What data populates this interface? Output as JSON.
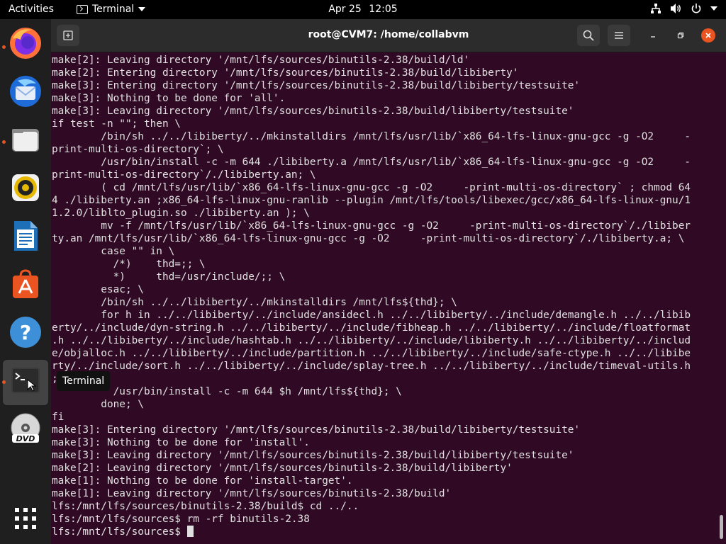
{
  "topbar": {
    "activities": "Activities",
    "app_name": "Terminal",
    "date": "Apr 25",
    "time": "12:05"
  },
  "dock": {
    "tooltip": "Terminal",
    "items": [
      "firefox",
      "thunderbird",
      "files",
      "rhythmbox",
      "libreoffice-writer",
      "ubuntu-software",
      "help",
      "terminal",
      "dvd",
      "show-applications"
    ]
  },
  "window": {
    "title": "root@CVM7: /home/collabvm"
  },
  "terminal": {
    "lines": [
      "make[2]: Leaving directory '/mnt/lfs/sources/binutils-2.38/build/ld'",
      "make[2]: Entering directory '/mnt/lfs/sources/binutils-2.38/build/libiberty'",
      "make[3]: Entering directory '/mnt/lfs/sources/binutils-2.38/build/libiberty/testsuite'",
      "make[3]: Nothing to be done for 'all'.",
      "make[3]: Leaving directory '/mnt/lfs/sources/binutils-2.38/build/libiberty/testsuite'",
      "if test -n \"\"; then \\",
      "        /bin/sh ../../libiberty/../mkinstalldirs /mnt/lfs/usr/lib/`x86_64-lfs-linux-gnu-gcc -g -O2     -",
      "print-multi-os-directory`; \\",
      "        /usr/bin/install -c -m 644 ./libiberty.a /mnt/lfs/usr/lib/`x86_64-lfs-linux-gnu-gcc -g -O2     -",
      "print-multi-os-directory`/./libiberty.an; \\",
      "        ( cd /mnt/lfs/usr/lib/`x86_64-lfs-linux-gnu-gcc -g -O2     -print-multi-os-directory` ; chmod 64",
      "4 ./libiberty.an ;x86_64-lfs-linux-gnu-ranlib --plugin /mnt/lfs/tools/libexec/gcc/x86_64-lfs-linux-gnu/1",
      "1.2.0/liblto_plugin.so ./libiberty.an ); \\",
      "        mv -f /mnt/lfs/usr/lib/`x86_64-lfs-linux-gnu-gcc -g -O2     -print-multi-os-directory`/./libiber",
      "ty.an /mnt/lfs/usr/lib/`x86_64-lfs-linux-gnu-gcc -g -O2     -print-multi-os-directory`/./libiberty.a; \\",
      "        case \"\" in \\",
      "          /*)    thd=;; \\",
      "          *)     thd=/usr/include/;; \\",
      "        esac; \\",
      "        /bin/sh ../../libiberty/../mkinstalldirs /mnt/lfs${thd}; \\",
      "        for h in ../../libiberty/../include/ansidecl.h ../../libiberty/../include/demangle.h ../../libib",
      "erty/../include/dyn-string.h ../../libiberty/../include/fibheap.h ../../libiberty/../include/floatformat",
      ".h ../../libiberty/../include/hashtab.h ../../libiberty/../include/libiberty.h ../../libiberty/../includ",
      "e/objalloc.h ../../libiberty/../include/partition.h ../../libiberty/../include/safe-ctype.h ../../libibe",
      "rty/../include/sort.h ../../libiberty/../include/splay-tree.h ../../libiberty/../include/timeval-utils.h",
      "; do \\",
      "          /usr/bin/install -c -m 644 $h /mnt/lfs${thd}; \\",
      "        done; \\",
      "fi",
      "make[3]: Entering directory '/mnt/lfs/sources/binutils-2.38/build/libiberty/testsuite'",
      "make[3]: Nothing to be done for 'install'.",
      "make[3]: Leaving directory '/mnt/lfs/sources/binutils-2.38/build/libiberty/testsuite'",
      "make[2]: Leaving directory '/mnt/lfs/sources/binutils-2.38/build/libiberty'",
      "make[1]: Nothing to be done for 'install-target'.",
      "make[1]: Leaving directory '/mnt/lfs/sources/binutils-2.38/build'",
      "lfs:/mnt/lfs/sources/binutils-2.38/build$ cd ../..",
      "lfs:/mnt/lfs/sources$ rm -rf binutils-2.38",
      "lfs:/mnt/lfs/sources$ "
    ]
  }
}
